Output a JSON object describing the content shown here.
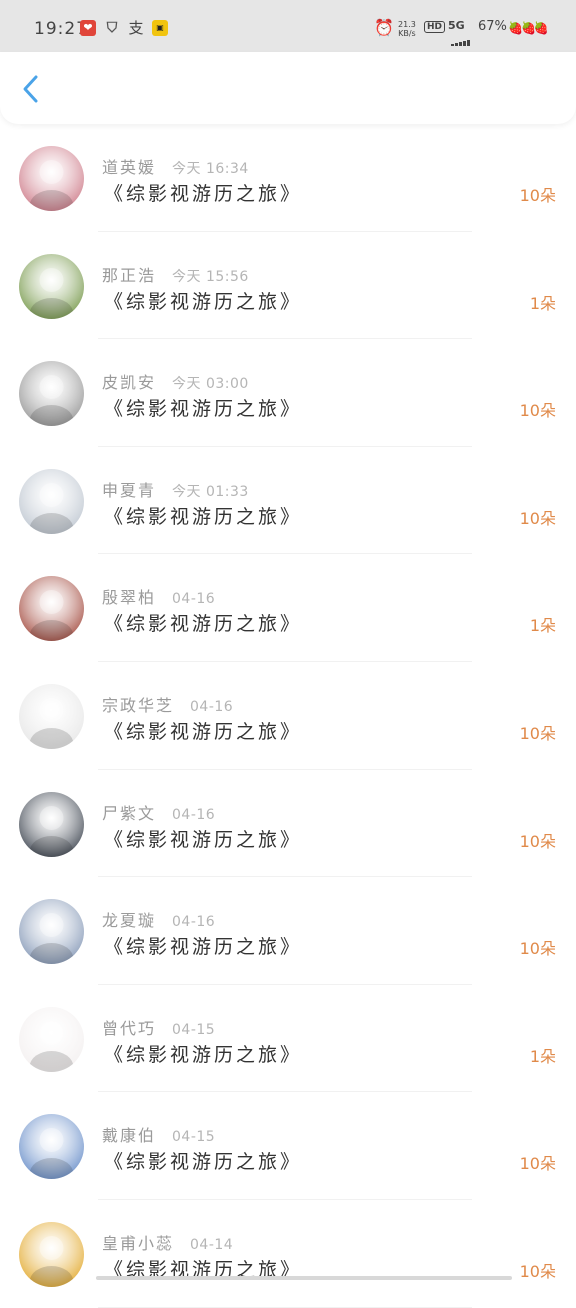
{
  "status_bar": {
    "time": "19:27",
    "speed": "21.3",
    "speed_unit": "KB/s",
    "hd": "HD",
    "network": "5G",
    "battery": "67%"
  },
  "nav": {
    "back_icon": "chevron-left-icon"
  },
  "list": [
    {
      "name": "道英媛",
      "time": "今天 16:34",
      "title": "《综影视游历之旅》",
      "amount": "10朵",
      "avatar_color": "#c96f7e"
    },
    {
      "name": "那正浩",
      "time": "今天 15:56",
      "title": "《综影视游历之旅》",
      "amount": "1朵",
      "avatar_color": "#6a8f3a"
    },
    {
      "name": "皮凯安",
      "time": "今天 03:00",
      "title": "《综影视游历之旅》",
      "amount": "10朵",
      "avatar_color": "#8c8c8c"
    },
    {
      "name": "申夏青",
      "time": "今天 01:33",
      "title": "《综影视游历之旅》",
      "amount": "10朵",
      "avatar_color": "#b8c1cc"
    },
    {
      "name": "殷翠柏",
      "time": "04-16",
      "title": "《综影视游历之旅》",
      "amount": "1朵",
      "avatar_color": "#9b3b2e"
    },
    {
      "name": "宗政华芝",
      "time": "04-16",
      "title": "《综影视游历之旅》",
      "amount": "10朵",
      "avatar_color": "#e4e4e4"
    },
    {
      "name": "尸紫文",
      "time": "04-16",
      "title": "《综影视游历之旅》",
      "amount": "10朵",
      "avatar_color": "#2c3440"
    },
    {
      "name": "龙夏璇",
      "time": "04-16",
      "title": "《综影视游历之旅》",
      "amount": "10朵",
      "avatar_color": "#7a8fb0"
    },
    {
      "name": "曾代巧",
      "time": "04-15",
      "title": "《综影视游历之旅》",
      "amount": "1朵",
      "avatar_color": "#f2eeee"
    },
    {
      "name": "戴康伯",
      "time": "04-15",
      "title": "《综影视游历之旅》",
      "amount": "10朵",
      "avatar_color": "#5b84c4"
    },
    {
      "name": "皇甫小蕊",
      "time": "04-14",
      "title": "《综影视游历之旅》",
      "amount": "10朵",
      "avatar_color": "#e0a21c"
    }
  ]
}
